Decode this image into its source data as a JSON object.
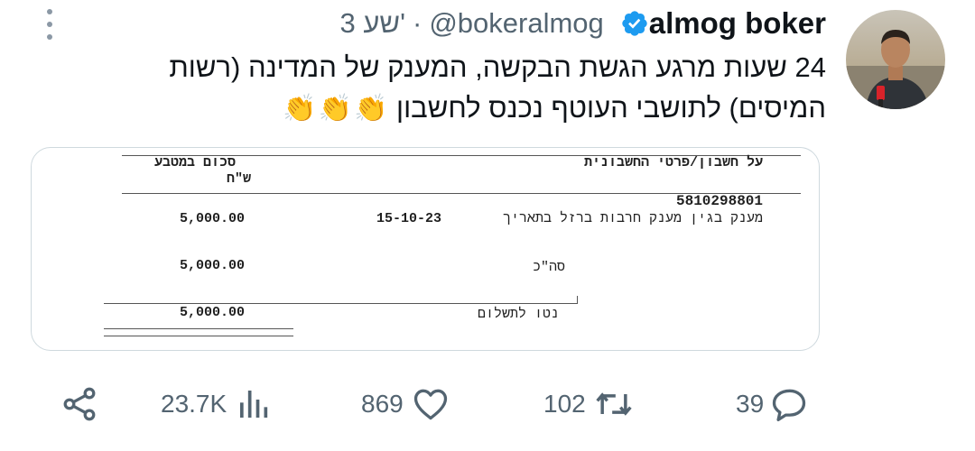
{
  "tweet": {
    "author_name": "almog boker",
    "handle": "@bokeralmog",
    "separator": "·",
    "time": "3 שע'",
    "text": "24 שעות מרגע הגשת הבקשה, המענק של המדינה (רשות המיסים) לתושבי העוטף נכנס לחשבון",
    "emojis": [
      "👏",
      "👏",
      "👏"
    ]
  },
  "document": {
    "header_account": "על חשבון/פרטי החשבונית",
    "header_amount": "סכום במטבע",
    "header_currency": "ש\"ח",
    "account_number": "5810298801",
    "line_description": "מענק בגין מענק חרבות ברזל בתאריך",
    "line_date": "15-10-23",
    "line_amount": "5,000.00",
    "subtotal_label": "סה\"כ",
    "subtotal_amount": "5,000.00",
    "net_label": "נטו לתשלום",
    "net_amount": "5,000.00"
  },
  "actions": {
    "views": "23.7K",
    "likes": "869",
    "retweets": "102",
    "replies": "39"
  },
  "colors": {
    "text": "#0f1419",
    "secondary": "#536471",
    "verified": "#1d9bf0",
    "border": "#cfd9de"
  },
  "icons": [
    "more-icon",
    "verified-badge-icon",
    "share-icon",
    "views-icon",
    "like-icon",
    "retweet-icon",
    "reply-icon",
    "clap-emoji"
  ]
}
